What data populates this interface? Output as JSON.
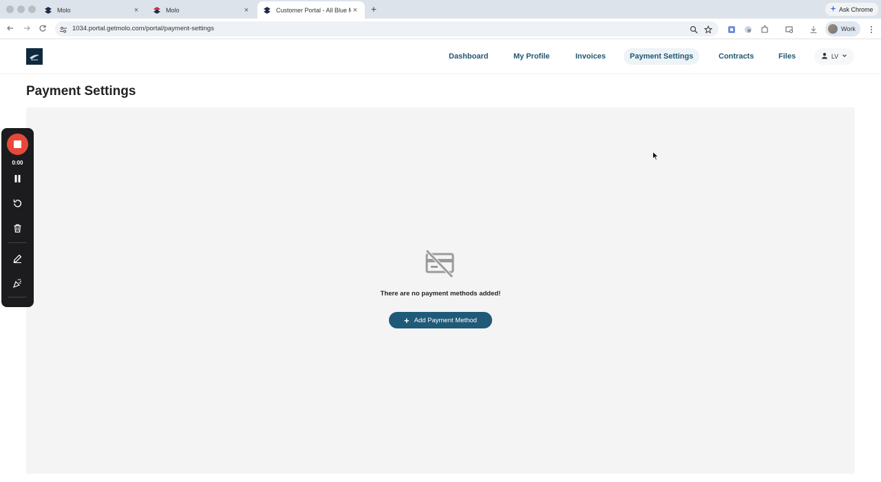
{
  "browser": {
    "tabs": [
      {
        "title": "Molo",
        "active": false
      },
      {
        "title": "Molo",
        "active": false
      },
      {
        "title": "Customer Portal - All Blue Ma",
        "active": true
      }
    ],
    "new_tab": "+",
    "close_glyph": "×",
    "ask_chrome_label": "Ask Chrome",
    "url": "1034.portal.getmolo.com/portal/payment-settings",
    "profile_label": "Work"
  },
  "site": {
    "nav": [
      {
        "label": "Dashboard"
      },
      {
        "label": "My Profile"
      },
      {
        "label": "Invoices"
      },
      {
        "label": "Payment Settings"
      },
      {
        "label": "Contracts"
      },
      {
        "label": "Files"
      }
    ],
    "active_nav": "Payment Settings",
    "user_initials": "LV"
  },
  "page": {
    "title": "Payment Settings",
    "empty_message": "There are no payment methods added!",
    "add_button_label": "Add Payment Method",
    "add_button_icon": "plus-icon"
  },
  "recorder": {
    "time": "0:00",
    "icons": [
      "stop-icon",
      "pause-icon",
      "restart-icon",
      "trash-icon",
      "pen-icon",
      "confetti-icon"
    ]
  },
  "colors": {
    "primary": "#1f5a78",
    "nav_text": "#1f5672",
    "record_red": "#e8483b",
    "panel_bg": "#f4f4f4"
  }
}
